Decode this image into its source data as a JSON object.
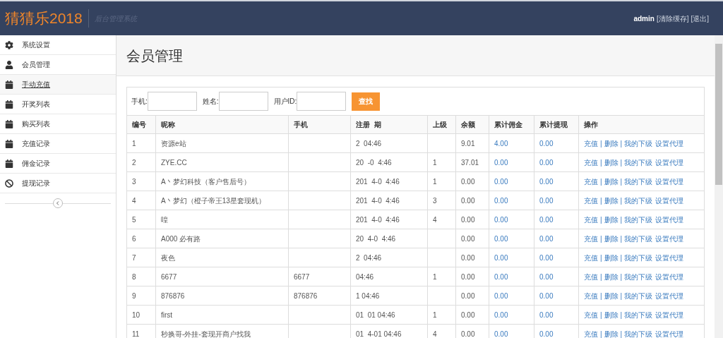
{
  "header": {
    "logo": "猜猜乐2018",
    "subtitle": "后台管理系统",
    "user": "admin",
    "links": [
      "[清除缓存]",
      "[退出]"
    ]
  },
  "sidebar": {
    "items": [
      {
        "label": "系统设置",
        "kind": "settings",
        "selected": false
      },
      {
        "label": "会员管理",
        "kind": "user",
        "selected": false
      },
      {
        "label": "手动充值",
        "kind": "calendar",
        "selected": true
      },
      {
        "label": "开奖列表",
        "kind": "calendar",
        "selected": false
      },
      {
        "label": "购买列表",
        "kind": "calendar",
        "selected": false
      },
      {
        "label": "充值记录",
        "kind": "calendar",
        "selected": false
      },
      {
        "label": "佣金记录",
        "kind": "calendar",
        "selected": false
      },
      {
        "label": "提现记录",
        "kind": "ban",
        "selected": false
      }
    ]
  },
  "page_title": "会员管理",
  "search": {
    "fields": [
      {
        "label": "手机:"
      },
      {
        "label": "姓名:"
      },
      {
        "label": "用户ID:"
      }
    ],
    "button": "查找"
  },
  "table": {
    "columns": [
      "编号",
      "昵称",
      "手机",
      "注册  期",
      "上级",
      "余额",
      "累计佣金",
      "累计提现",
      "操作"
    ],
    "action_separator": "|",
    "rows": [
      {
        "cells": [
          "1",
          "资源e站",
          "",
          "2  04:46",
          "",
          "9.01",
          "4.00",
          "0.00"
        ],
        "actions": [
          "充值",
          "删除",
          "我的下级",
          "设置代理"
        ]
      },
      {
        "cells": [
          "2",
          "ZYE.CC",
          "",
          "20  -0  4:46",
          "1",
          "37.01",
          "0.00",
          "0.00"
        ],
        "actions": [
          "充值",
          "删除",
          "我的下级",
          "设置代理"
        ]
      },
      {
        "cells": [
          "3",
          "A丶梦幻科技（客户售后号）",
          "",
          "201  4-0  4:46",
          "1",
          "0.00",
          "0.00",
          "0.00"
        ],
        "actions": [
          "充值",
          "删除",
          "我的下级",
          "设置代理"
        ]
      },
      {
        "cells": [
          "4",
          "A丶梦幻（橙子帝王13星套现机）",
          "",
          "201  4-0  4:46",
          "3",
          "0.00",
          "0.00",
          "0.00"
        ],
        "actions": [
          "充值",
          "删除",
          "我的下级",
          "设置代理"
        ]
      },
      {
        "cells": [
          "5",
          "喤",
          "",
          "201  4-0  4:46",
          "4",
          "0.00",
          "0.00",
          "0.00"
        ],
        "actions": [
          "充值",
          "删除",
          "我的下级",
          "设置代理"
        ]
      },
      {
        "cells": [
          "6",
          "A000 必有路",
          "",
          "20  4-0  4:46",
          "",
          "0.00",
          "0.00",
          "0.00"
        ],
        "actions": [
          "充值",
          "删除",
          "我的下级",
          "设置代理"
        ]
      },
      {
        "cells": [
          "7",
          "夜色",
          "",
          "2  04:46",
          "",
          "0.00",
          "0.00",
          "0.00"
        ],
        "actions": [
          "充值",
          "删除",
          "我的下级",
          "设置代理"
        ]
      },
      {
        "cells": [
          "8",
          "6677",
          "6677",
          "04:46",
          "1",
          "0.00",
          "0.00",
          "0.00"
        ],
        "actions": [
          "充值",
          "删除",
          "我的下级",
          "设置代理"
        ]
      },
      {
        "cells": [
          "9",
          "876876",
          "876876",
          "1 04:46",
          "",
          "0.00",
          "0.00",
          "0.00"
        ],
        "actions": [
          "充值",
          "删除",
          "我的下级",
          "设置代理"
        ]
      },
      {
        "cells": [
          "10",
          "first",
          "",
          "01  01 04:46",
          "1",
          "0.00",
          "0.00",
          "0.00"
        ],
        "actions": [
          "充值",
          "删除",
          "我的下级",
          "设置代理"
        ]
      },
      {
        "cells": [
          "11",
          "秒换哥-外挂-套现开商户找我",
          "",
          "01  4-01 04:46",
          "4",
          "0.00",
          "0.00",
          "0.00"
        ],
        "actions": [
          "充值",
          "删除",
          "我的下级",
          "设置代理"
        ]
      }
    ]
  }
}
